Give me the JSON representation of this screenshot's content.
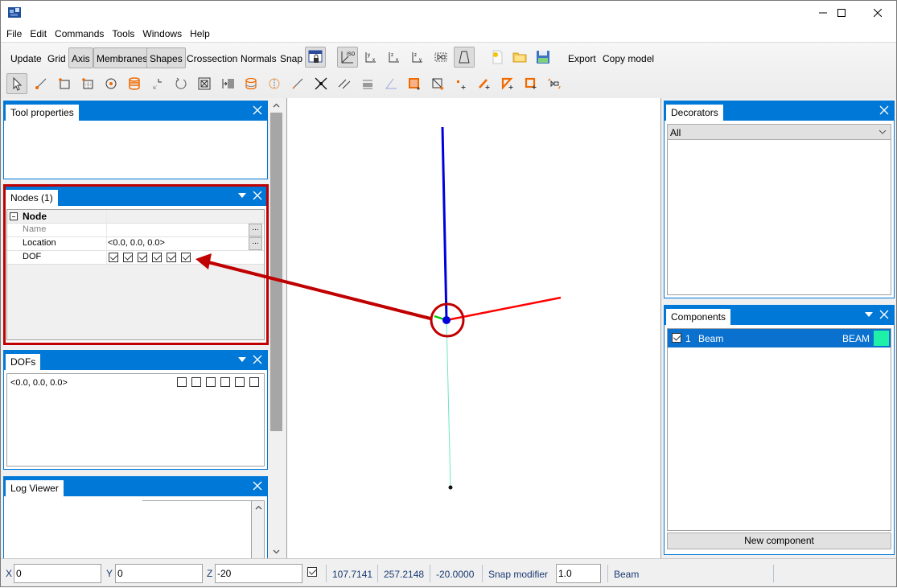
{
  "window": {
    "app_icon": "app-logo-icon",
    "controls": {
      "minimize": "minimize-icon",
      "maximize": "maximize-icon",
      "close": "close-icon"
    }
  },
  "menu": [
    "File",
    "Edit",
    "Commands",
    "Tools",
    "Windows",
    "Help"
  ],
  "toolbar_top": {
    "text_buttons": [
      {
        "label": "Update",
        "pressed": false
      },
      {
        "label": "Grid",
        "pressed": false
      },
      {
        "label": "Axis",
        "pressed": true
      },
      {
        "label": "Membranes",
        "pressed": true
      },
      {
        "label": "Shapes",
        "pressed": true
      },
      {
        "label": "Crossection",
        "pressed": false
      },
      {
        "label": "Normals",
        "pressed": false
      },
      {
        "label": "Snap",
        "pressed": false
      }
    ],
    "icon_buttons": [
      "lock-view-icon",
      "iso-view-icon",
      "xy-view-icon",
      "xz-view-icon",
      "yz-view-icon",
      "section-view-icon",
      "perspective-icon",
      "new-file-icon",
      "open-folder-icon",
      "save-icon"
    ],
    "export_label": "Export",
    "copy_model_label": "Copy model"
  },
  "toolbar_bottom": {
    "icons": [
      "select-icon",
      "draw-line-icon",
      "add-rectangle-icon",
      "add-grid-rectangle-icon",
      "add-circle-node-icon",
      "stack-icon",
      "move-icon",
      "rotate-icon",
      "fit-view-icon",
      "array-icon",
      "cylinder-icon",
      "sphere-section-icon",
      "line-icon",
      "intersection-icon",
      "parallel-lines-icon",
      "beam-section-icon",
      "angle-icon",
      "add-filled-membrane-icon",
      "add-diagonal-icon",
      "add-point-icon",
      "add-line-icon",
      "add-triangle-icon",
      "add-square-icon",
      "snap-section-icon"
    ]
  },
  "panels": {
    "tool_properties": {
      "title": "Tool properties"
    },
    "nodes": {
      "title": "Nodes (1)",
      "group": "Node",
      "rows": [
        {
          "name": "Name",
          "value": "",
          "has_button": true,
          "button_label": "..."
        },
        {
          "name": "Location",
          "value": "<0.0, 0.0, 0.0>",
          "has_button": true,
          "button_label": "..."
        },
        {
          "name": "DOF",
          "dof_checked": [
            true,
            true,
            true,
            true,
            true,
            true
          ]
        }
      ]
    },
    "dofs": {
      "title": "DOFs",
      "location": "<0.0, 0.0, 0.0>",
      "dof_checked": [
        false,
        false,
        false,
        false,
        false,
        false
      ]
    },
    "log_viewer": {
      "title": "Log Viewer"
    },
    "decorators": {
      "title": "Decorators",
      "filter_selected": "All"
    },
    "components": {
      "title": "Components",
      "items": [
        {
          "checked": true,
          "index": "1",
          "name": "Beam",
          "type": "BEAM",
          "color": "#1ef0a8"
        }
      ],
      "new_button": "New component"
    }
  },
  "viewport": {
    "axis_colors": {
      "x": "#ff0000",
      "y": "#00cc00",
      "z": "#0000dd",
      "beam": "#6ee6c8"
    },
    "annotation_color": "#c00000"
  },
  "statusbar": {
    "x_label": "X",
    "x_value": "0",
    "y_label": "Y",
    "y_value": "0",
    "z_label": "Z",
    "z_value": "-20",
    "checkbox_checked": true,
    "coord_x": "107.7141",
    "coord_y": "257.2148",
    "coord_z": "-20.0000",
    "snap_modifier_label": "Snap modifier",
    "snap_modifier_value": "1.0",
    "active_component": "Beam"
  }
}
